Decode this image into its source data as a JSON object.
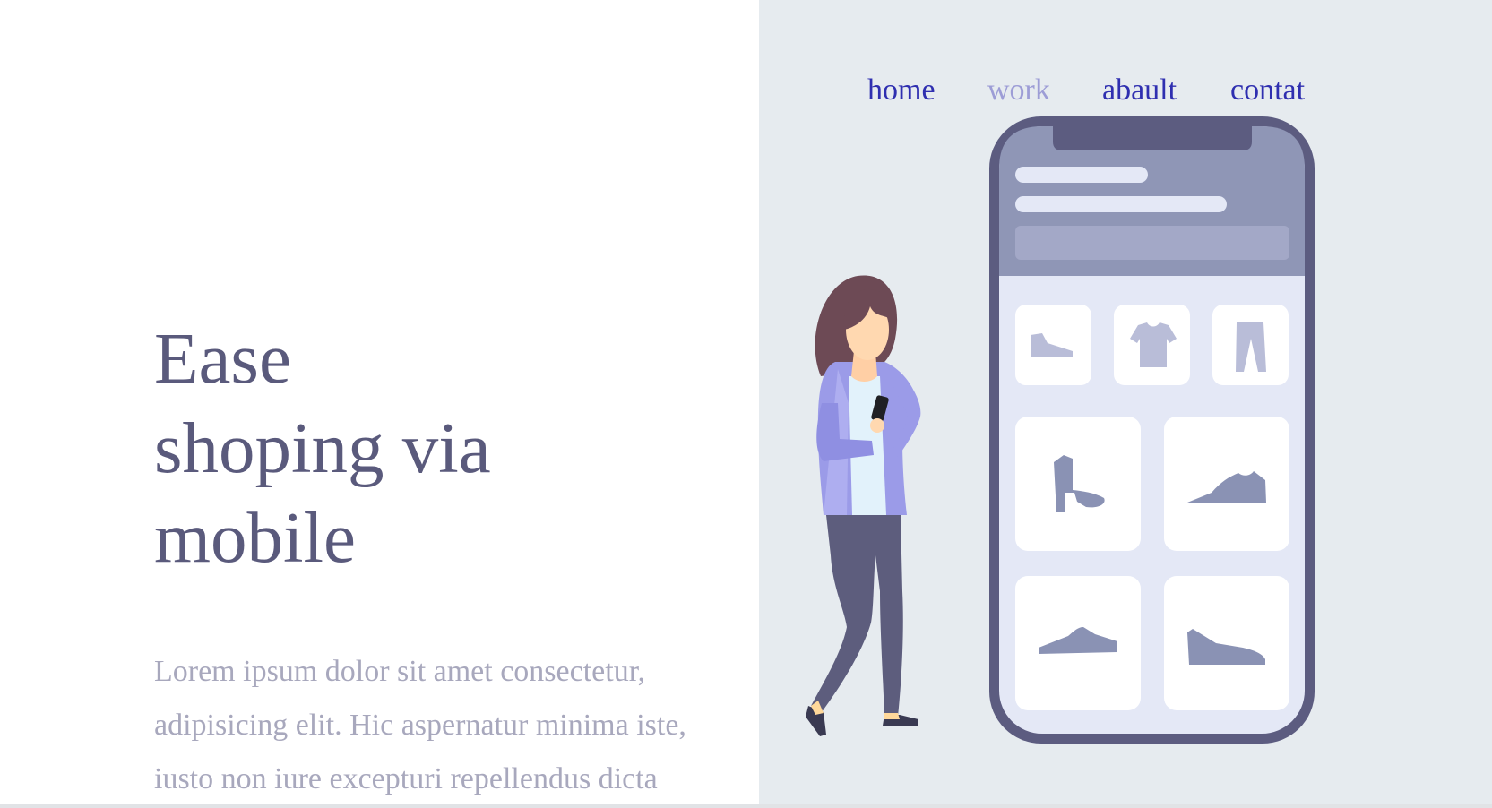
{
  "nav": {
    "items": [
      {
        "label": "home",
        "active": false
      },
      {
        "label": "work",
        "active": true
      },
      {
        "label": "abault",
        "active": false
      },
      {
        "label": "contat",
        "active": false
      }
    ]
  },
  "hero": {
    "title_lines": [
      "Ease",
      "shoping via",
      "mobile"
    ],
    "paragraph": "Lorem ipsum dolor sit amet consectetur, adipisicing elit. Hic aspernatur minima iste, iusto non iure excepturi repellendus dicta"
  },
  "illustration": {
    "phone_categories": [
      "shoe-icon",
      "tshirt-icon",
      "pants-icon"
    ],
    "phone_products": [
      "boot-icon",
      "sneaker-icon",
      "shoe-icon",
      "sneaker-icon"
    ]
  },
  "colors": {
    "nav_link": "#2f2fb0",
    "nav_active": "#9d9dd6",
    "title": "#5a5a7c",
    "paragraph": "#a8a8bd",
    "right_bg": "#e6ebef"
  }
}
